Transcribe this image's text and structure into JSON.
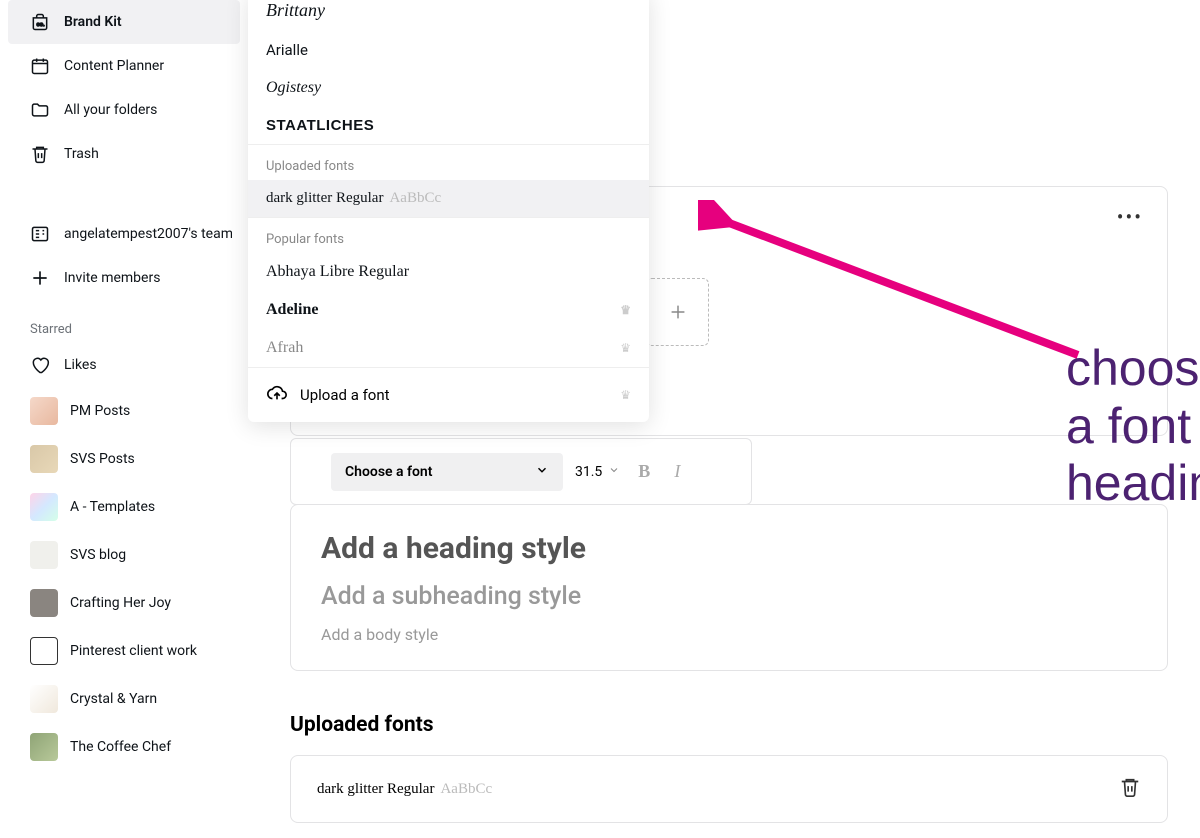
{
  "sidebar": {
    "brandKit": "Brand Kit",
    "contentPlanner": "Content Planner",
    "allFolders": "All your folders",
    "trash": "Trash",
    "team": "angelatempest2007's team",
    "invite": "Invite members",
    "starredLabel": "Starred",
    "likes": "Likes",
    "starred": {
      "pm": "PM Posts",
      "svs": "SVS Posts",
      "a": "A - Templates",
      "blog": "SVS blog",
      "craft": "Crafting Her Joy",
      "pin": "Pinterest client work",
      "crystal": "Crystal & Yarn",
      "coffee": "The Coffee Chef"
    }
  },
  "dropdown": {
    "brittany": "Brittany",
    "arialle": "Arialle",
    "ogistesy": "Ogistesy",
    "staatliches": "Staatliches",
    "uploadedLabel": "Uploaded fonts",
    "darkGlitter": "dark glitter Regular",
    "sample": "AaBbCc",
    "popularLabel": "Popular fonts",
    "abhaya": "Abhaya Libre Regular",
    "adeline": "Adeline",
    "afrah": "Afrah",
    "uploadAction": "Upload a font"
  },
  "toolbar": {
    "chooseFont": "Choose a font",
    "size": "31.5"
  },
  "styles": {
    "heading": "Add a heading style",
    "subheading": "Add a subheading style",
    "body": "Add a body style"
  },
  "uploaded": {
    "title": "Uploaded fonts",
    "fontName": "dark glitter Regular",
    "sample": "AaBbCc"
  },
  "annotation": "choosing a font for headings"
}
